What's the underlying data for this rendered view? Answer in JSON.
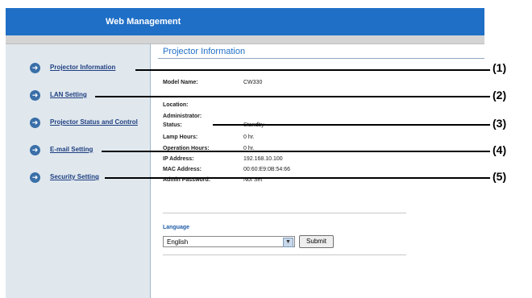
{
  "header": {
    "title": "Web Management"
  },
  "sidebar": {
    "items": [
      {
        "label": "Projector Information"
      },
      {
        "label": "LAN Setting"
      },
      {
        "label": "Projector Status and Control"
      },
      {
        "label": "E-mail Setting"
      },
      {
        "label": "Security Setting"
      }
    ]
  },
  "main": {
    "title": "Projector Information",
    "fields": [
      {
        "label": "Model Name:",
        "value": "CW330"
      },
      {
        "label": "Location:",
        "value": ""
      },
      {
        "label": "Administrator:",
        "value": ""
      },
      {
        "label": "Status:",
        "value": "Standby"
      },
      {
        "label": "Lamp Hours:",
        "value": "0 hr."
      },
      {
        "label": "Operation Hours:",
        "value": "0 hr."
      },
      {
        "label": "IP Address:",
        "value": "192.168.10.100"
      },
      {
        "label": "MAC Address:",
        "value": "00:60:E9:0B:54:66"
      },
      {
        "label": "Admin Password:",
        "value": "Not Set"
      }
    ]
  },
  "language": {
    "title": "Language",
    "selected": "English",
    "submit_label": "Submit"
  },
  "callouts": [
    "(1)",
    "(2)",
    "(3)",
    "(4)",
    "(5)"
  ]
}
